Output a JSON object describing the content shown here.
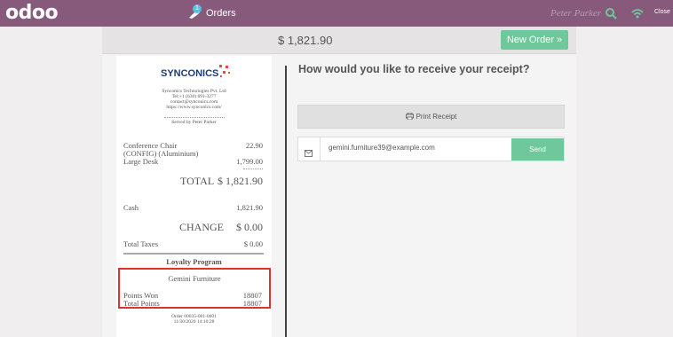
{
  "topbar": {
    "logo": "odoo",
    "orders_label": "Orders",
    "orders_count": "1",
    "cashier": "Peter Parker",
    "close_label": "Close",
    "search_icon": "search-icon",
    "wifi_icon": "wifi-icon",
    "accent": "#875a7b"
  },
  "header": {
    "total": "$ 1,821.90",
    "new_order_label": "New Order »"
  },
  "receipt": {
    "company_name": "SYNCONICS",
    "company_info": [
      "Synconics Technologies Pvt. Ltd",
      "Tel:+1 (630) 691-3277",
      "contact@synconics.com",
      "https://www.synconics.com/"
    ],
    "served_by": "Served by Peter Parker",
    "lines": [
      {
        "name": "Conference Chair",
        "price": "22.90"
      },
      {
        "name": "(CONFIG) (Aluminium)",
        "price": ""
      },
      {
        "name": "Large Desk",
        "price": "1,799.00"
      }
    ],
    "total_label": "TOTAL",
    "total_value": "$ 1,821.90",
    "payment_label": "Cash",
    "payment_value": "1,821.90",
    "change_label": "CHANGE",
    "change_value": "$ 0.00",
    "taxes_label": "Total Taxes",
    "taxes_value": "$ 0.00",
    "loyalty_title": "Loyalty Program",
    "loyalty_customer": "Gemini Furniture",
    "points_won_label": "Points Won",
    "points_won_value": "18807",
    "total_points_label": "Total Points",
    "total_points_value": "18807",
    "order_ref": "Order 00035-001-0001",
    "order_date": "11/30/2020 14:10:28"
  },
  "receipt_panel": {
    "question": "How would you like to receive your receipt?",
    "print_label": "Print Receipt",
    "email_value": "gemini.furniture39@example.com",
    "send_label": "Send"
  }
}
